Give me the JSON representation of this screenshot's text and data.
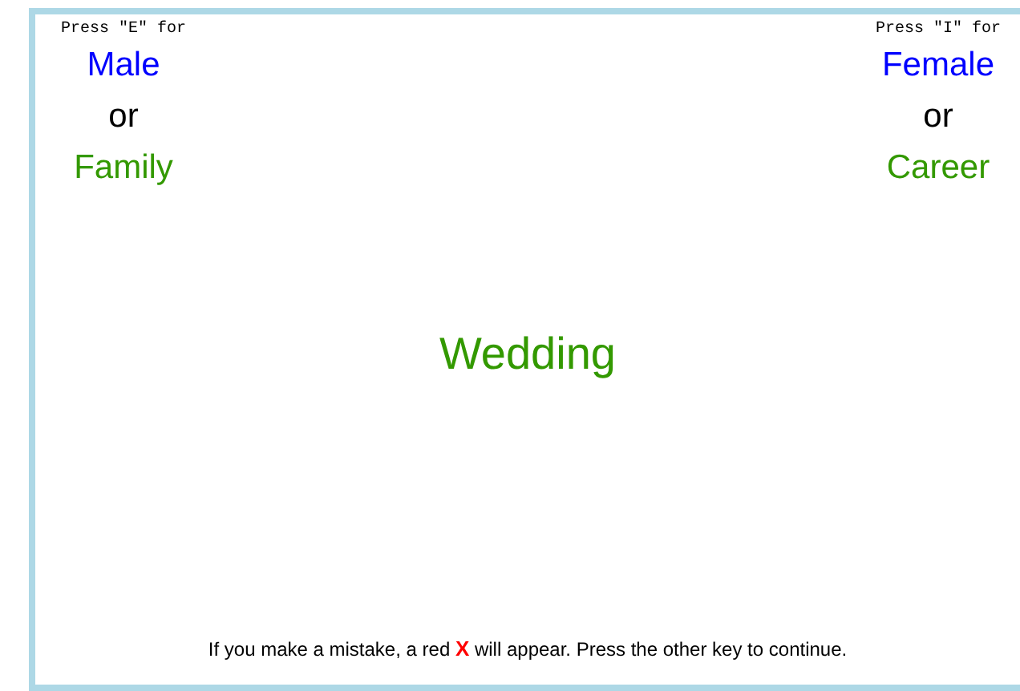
{
  "left_panel": {
    "key_prompt": "Press \"E\" for",
    "top_category": {
      "text": "Male",
      "color": "#0000ff"
    },
    "joiner": "or",
    "bottom_category": {
      "text": "Family",
      "color": "#339900"
    }
  },
  "right_panel": {
    "key_prompt": "Press \"I\" for",
    "top_category": {
      "text": "Female",
      "color": "#0000ff"
    },
    "joiner": "or",
    "bottom_category": {
      "text": "Career",
      "color": "#339900"
    }
  },
  "stimulus": {
    "text": "Wedding",
    "color": "#339900"
  },
  "instruction": "If you make a mistake, a red **X** will appear. Press the other key to continue."
}
